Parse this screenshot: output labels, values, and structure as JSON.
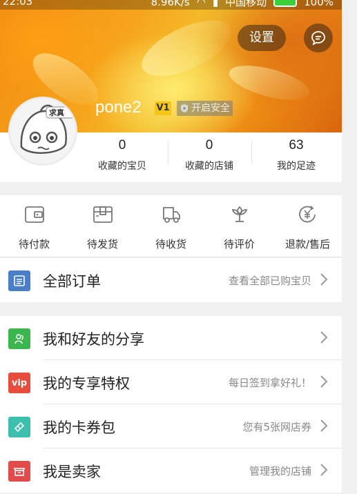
{
  "status_bar": {
    "time": "22:03",
    "speed": "8.96K/s",
    "carrier": "中国移动",
    "battery": "100%"
  },
  "header": {
    "settings_label": "设置",
    "username": "pone2",
    "vip_level": "V1",
    "safety_label": "开启安全",
    "avatar_tag": "求真"
  },
  "stats": [
    {
      "value": "0",
      "label": "收藏的宝贝"
    },
    {
      "value": "0",
      "label": "收藏的店铺"
    },
    {
      "value": "63",
      "label": "我的足迹"
    }
  ],
  "order_tabs": [
    {
      "label": "待付款",
      "icon": "wallet-icon"
    },
    {
      "label": "待发货",
      "icon": "package-icon"
    },
    {
      "label": "待收货",
      "icon": "truck-icon"
    },
    {
      "label": "待评价",
      "icon": "flower-icon"
    },
    {
      "label": "退款/售后",
      "icon": "refund-icon"
    }
  ],
  "all_orders": {
    "title": "全部订单",
    "hint": "查看全部已购宝贝",
    "icon_color": "#4a7ec7"
  },
  "menu": [
    {
      "title": "我和好友的分享",
      "hint": "",
      "icon": "share-friends-icon",
      "icon_color": "#3cb64f"
    },
    {
      "title": "我的专享特权",
      "hint": "每日签到拿好礼！",
      "icon": "vip-icon",
      "icon_label": "vip",
      "icon_color": "#e74c3c"
    },
    {
      "title": "我的卡券包",
      "hint": "您有5张网店券",
      "icon": "coupon-icon",
      "icon_color": "#3dbfae"
    },
    {
      "title": "我是卖家",
      "hint": "管理我的店铺",
      "icon": "shop-icon",
      "icon_color": "#e14b4b"
    }
  ],
  "colors": {
    "banner_orange": "#f29a18",
    "vip_badge": "#f5c518"
  }
}
